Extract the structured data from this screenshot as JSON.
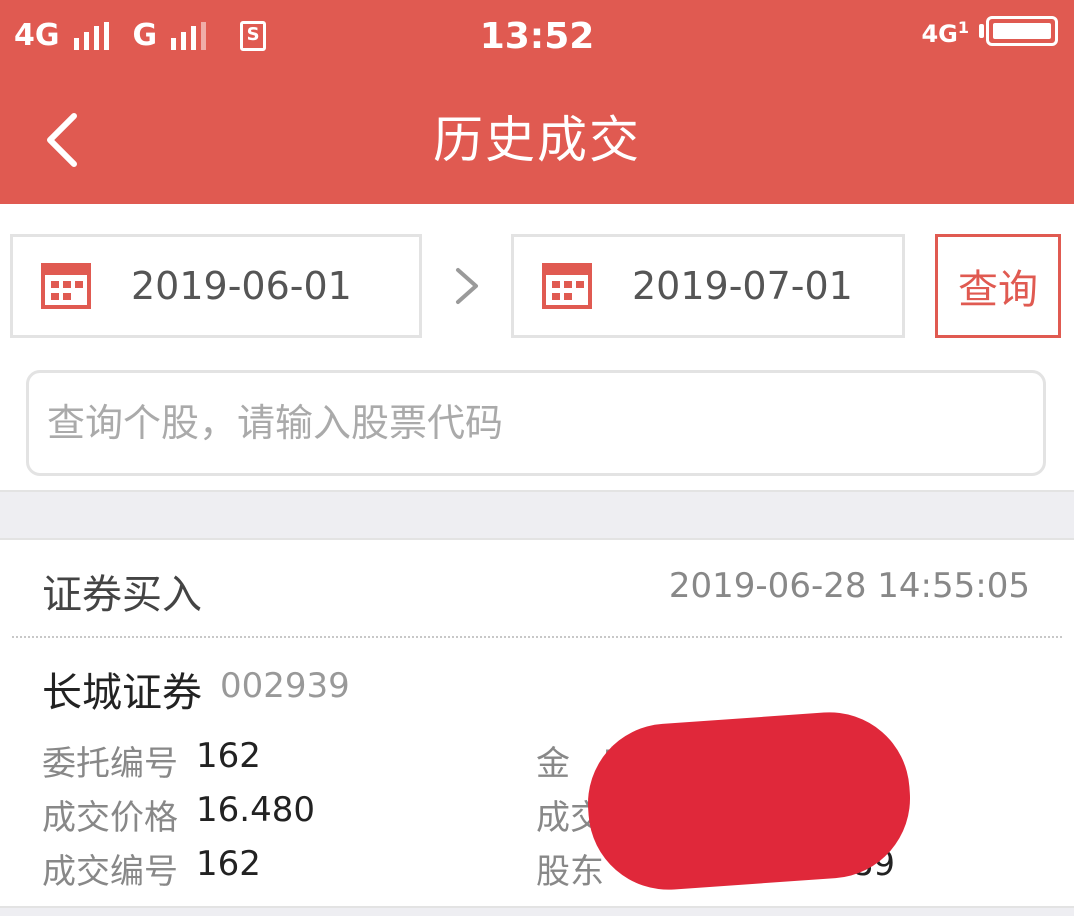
{
  "status_bar": {
    "network1": "4G",
    "network2": "G",
    "time": "13:52",
    "network_right": "4G",
    "network_right_sub": "1"
  },
  "header": {
    "title": "历史成交"
  },
  "filters": {
    "start_date": "2019-06-01",
    "end_date": "2019-07-01",
    "query_label": "查询",
    "search_placeholder": "查询个股，请输入股票代码"
  },
  "record": {
    "type": "证券买入",
    "time": "2019-06-28 14:55:05",
    "stock_name": "长城证券",
    "stock_code": "002939",
    "fields_left": [
      {
        "label": "委托编号",
        "value": "162"
      },
      {
        "label": "成交价格",
        "value": "16.480"
      },
      {
        "label": "成交编号",
        "value": "162"
      }
    ],
    "fields_right": [
      {
        "label": "金　额",
        "value": ""
      },
      {
        "label": "成交",
        "value": ""
      },
      {
        "label": "股东",
        "value": "04228189"
      }
    ]
  },
  "colors": {
    "brand": "#e05a51",
    "redaction": "#e0283a"
  }
}
